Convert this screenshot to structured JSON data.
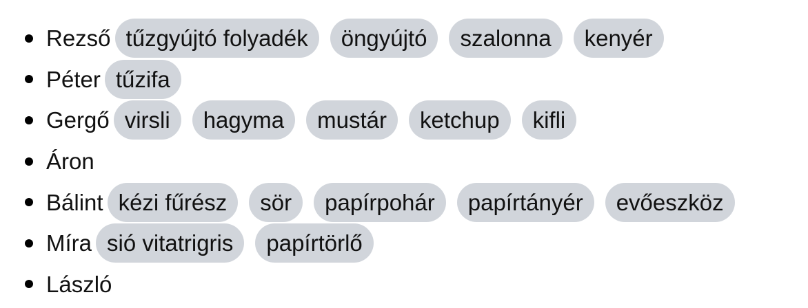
{
  "people": [
    {
      "name": "Rezső",
      "items": [
        "tűzgyújtó folyadék",
        "öngyújtó",
        "szalonna",
        "kenyér"
      ]
    },
    {
      "name": "Péter",
      "items": [
        "tűzifa"
      ]
    },
    {
      "name": "Gergő",
      "items": [
        "virsli",
        "hagyma",
        "mustár",
        "ketchup",
        "kifli"
      ]
    },
    {
      "name": "Áron",
      "items": []
    },
    {
      "name": "Bálint",
      "items": [
        "kézi fűrész",
        "sör",
        "papírpohár",
        "papírtányér",
        "evőeszköz"
      ]
    },
    {
      "name": "Míra",
      "items": [
        "sió vitatrigris",
        "papírtörlő"
      ]
    },
    {
      "name": "László",
      "items": []
    }
  ]
}
